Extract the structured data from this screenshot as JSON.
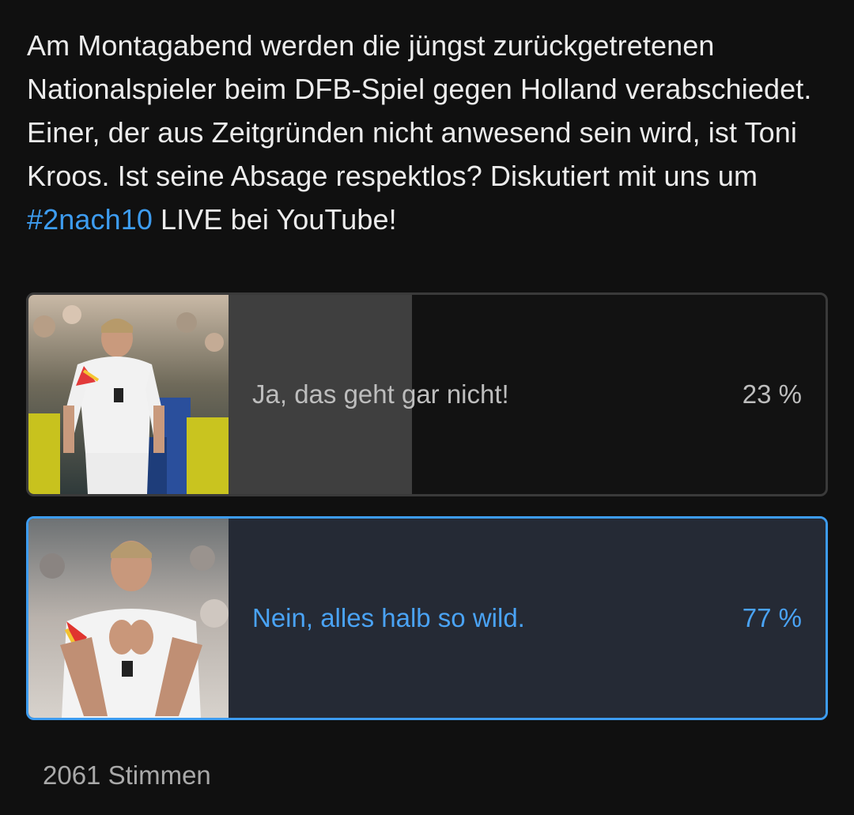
{
  "post": {
    "text_before_hashtag": "Am Montagabend werden die jüngst zurückgetretenen Nationalspieler beim DFB-Spiel gegen Holland verabschiedet. Einer, der aus Zeitgründen nicht anwesend sein wird, ist Toni Kroos. Ist seine Absage respektlos? Diskutiert mit uns um ",
    "hashtag": "#2nach10",
    "text_after_hashtag": " LIVE bei YouTube!"
  },
  "poll": {
    "options": [
      {
        "label": "Ja, das geht gar nicht!",
        "percent_text": "23 %",
        "share": 0.23,
        "selected": false,
        "image": "player-standing-photo"
      },
      {
        "label": "Nein, alles halb so wild.",
        "percent_text": "77 %",
        "share": 0.77,
        "selected": true,
        "image": "player-applauding-photo"
      }
    ],
    "votes_text": "2061 Stimmen"
  },
  "colors": {
    "background": "#101010",
    "accent": "#3d9cf0",
    "selected_bar": "#252a35",
    "unselected_bar": "#3f3f3f"
  }
}
